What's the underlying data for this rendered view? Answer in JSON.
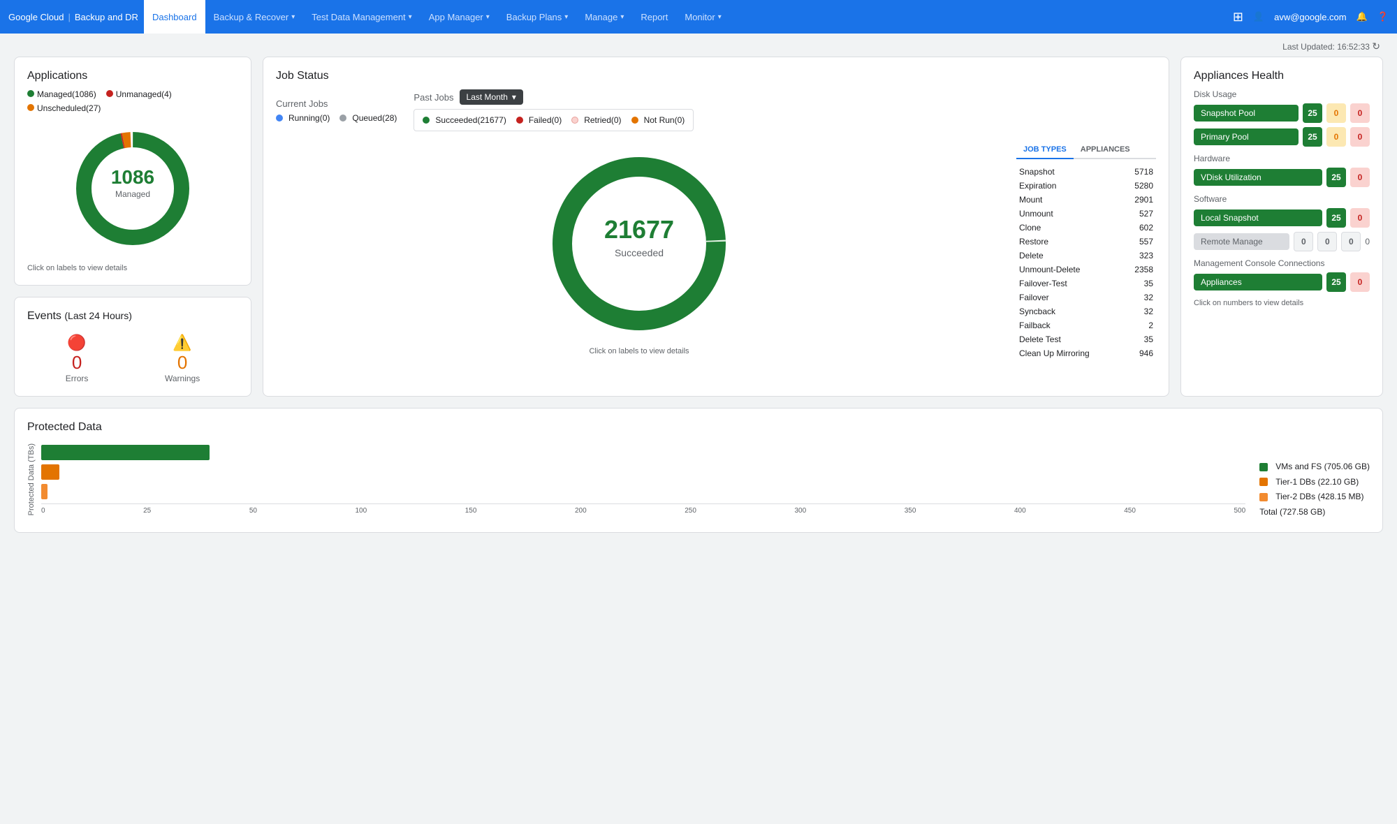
{
  "nav": {
    "brand_gc": "Google Cloud",
    "brand_app": "Backup and DR",
    "items": [
      {
        "label": "Dashboard",
        "active": true
      },
      {
        "label": "Backup & Recover",
        "dropdown": true
      },
      {
        "label": "Test Data Management",
        "dropdown": true
      },
      {
        "label": "App Manager",
        "dropdown": true
      },
      {
        "label": "Backup Plans",
        "dropdown": true
      },
      {
        "label": "Manage",
        "dropdown": true
      },
      {
        "label": "Report",
        "dropdown": false
      },
      {
        "label": "Monitor",
        "dropdown": true
      }
    ],
    "user": "avw@google.com"
  },
  "header": {
    "last_updated_label": "Last Updated:",
    "last_updated_time": "16:52:33"
  },
  "applications": {
    "title": "Applications",
    "legend": [
      {
        "label": "Managed(1086)",
        "color": "#1e7e34"
      },
      {
        "label": "Unmanaged(4)",
        "color": "#c5221f"
      },
      {
        "label": "Unscheduled(27)",
        "color": "#e37400"
      }
    ],
    "center_value": "1086",
    "center_label": "Managed",
    "footer": "Click on labels to view details",
    "donut_segments": [
      {
        "pct": 0.965,
        "color": "#1e7e34"
      },
      {
        "pct": 0.004,
        "color": "#c5221f"
      },
      {
        "pct": 0.024,
        "color": "#e37400"
      },
      {
        "pct": 0.007,
        "color": "#dadce0"
      }
    ]
  },
  "events": {
    "title": "Events",
    "subtitle": "(Last 24 Hours)",
    "errors_count": "0",
    "errors_label": "Errors",
    "warnings_count": "0",
    "warnings_label": "Warnings"
  },
  "job_status": {
    "title": "Job Status",
    "current_jobs_label": "Current Jobs",
    "past_jobs_label": "Past Jobs",
    "time_filter": "Last Month",
    "current_legend": [
      {
        "label": "Running(0)",
        "color": "#4285f4"
      },
      {
        "label": "Queued(28)",
        "color": "#9aa0a6"
      }
    ],
    "past_legend": [
      {
        "label": "Succeeded(21677)",
        "color": "#1e7e34"
      },
      {
        "label": "Failed(0)",
        "color": "#c5221f"
      },
      {
        "label": "Retried(0)",
        "color": "#fad2cf"
      },
      {
        "label": "Not Run(0)",
        "color": "#e37400"
      }
    ],
    "donut_center_value": "21677",
    "donut_center_label": "Succeeded",
    "footer": "Click on labels to view details",
    "tab_job_types": "JOB TYPES",
    "tab_appliances": "APPLIANCES",
    "job_types": [
      {
        "name": "Snapshot",
        "count": "5718"
      },
      {
        "name": "Expiration",
        "count": "5280"
      },
      {
        "name": "Mount",
        "count": "2901"
      },
      {
        "name": "Unmount",
        "count": "527"
      },
      {
        "name": "Clone",
        "count": "602"
      },
      {
        "name": "Restore",
        "count": "557"
      },
      {
        "name": "Delete",
        "count": "323"
      },
      {
        "name": "Unmount-Delete",
        "count": "2358"
      },
      {
        "name": "Failover-Test",
        "count": "35"
      },
      {
        "name": "Failover",
        "count": "32"
      },
      {
        "name": "Syncback",
        "count": "32"
      },
      {
        "name": "Failback",
        "count": "2"
      },
      {
        "name": "Delete Test",
        "count": "35"
      },
      {
        "name": "Clean Up Mirroring",
        "count": "946"
      }
    ]
  },
  "appliances_health": {
    "title": "Appliances Health",
    "disk_usage_label": "Disk Usage",
    "hardware_label": "Hardware",
    "software_label": "Software",
    "mgmt_label": "Management Console Connections",
    "rows": [
      {
        "section": "disk_usage",
        "name": "Snapshot Pool",
        "green": "25",
        "orange": "0",
        "red": "0",
        "gray": null
      },
      {
        "section": "disk_usage",
        "name": "Primary Pool",
        "green": "25",
        "orange": "0",
        "red": "0",
        "gray": null
      },
      {
        "section": "hardware",
        "name": "VDisk Utilization",
        "green": "25",
        "orange": null,
        "red": "0",
        "gray": null
      },
      {
        "section": "software",
        "name": "Local Snapshot",
        "green": "25",
        "orange": null,
        "red": "0",
        "gray": null
      },
      {
        "section": "software",
        "name": "Remote Manage",
        "green": "0",
        "orange": "0",
        "red": "0",
        "gray": "0"
      },
      {
        "section": "mgmt",
        "name": "Appliances",
        "green": "25",
        "orange": null,
        "red": "0",
        "gray": null
      }
    ],
    "footer": "Click on numbers to view details"
  },
  "protected_data": {
    "title": "Protected Data",
    "y_axis_label": "Protected Data (TBs)",
    "x_axis": [
      "0",
      "25",
      "50",
      "100",
      "150",
      "200",
      "250",
      "300",
      "350",
      "400",
      "450",
      "500"
    ],
    "legend": [
      {
        "label": "VMs and FS (705.06 GB)",
        "color": "#1e7e34"
      },
      {
        "label": "Tier-1 DBs (22.10 GB)",
        "color": "#e37400"
      },
      {
        "label": "Tier-2 DBs (428.15 MB)",
        "color": "#f28b30"
      },
      {
        "label": "Total (727.58 GB)",
        "color": null
      }
    ],
    "bars": [
      {
        "label": "VMs and FS",
        "value": 0.688,
        "color": "#1e7e34",
        "width_pct": 14
      },
      {
        "label": "Tier-1 DBs",
        "value": 0.022,
        "color": "#e37400",
        "width_pct": 1.5
      },
      {
        "label": "Tier-2 DBs",
        "value": 0.0004,
        "color": "#f28b30",
        "width_pct": 0.5
      }
    ]
  }
}
